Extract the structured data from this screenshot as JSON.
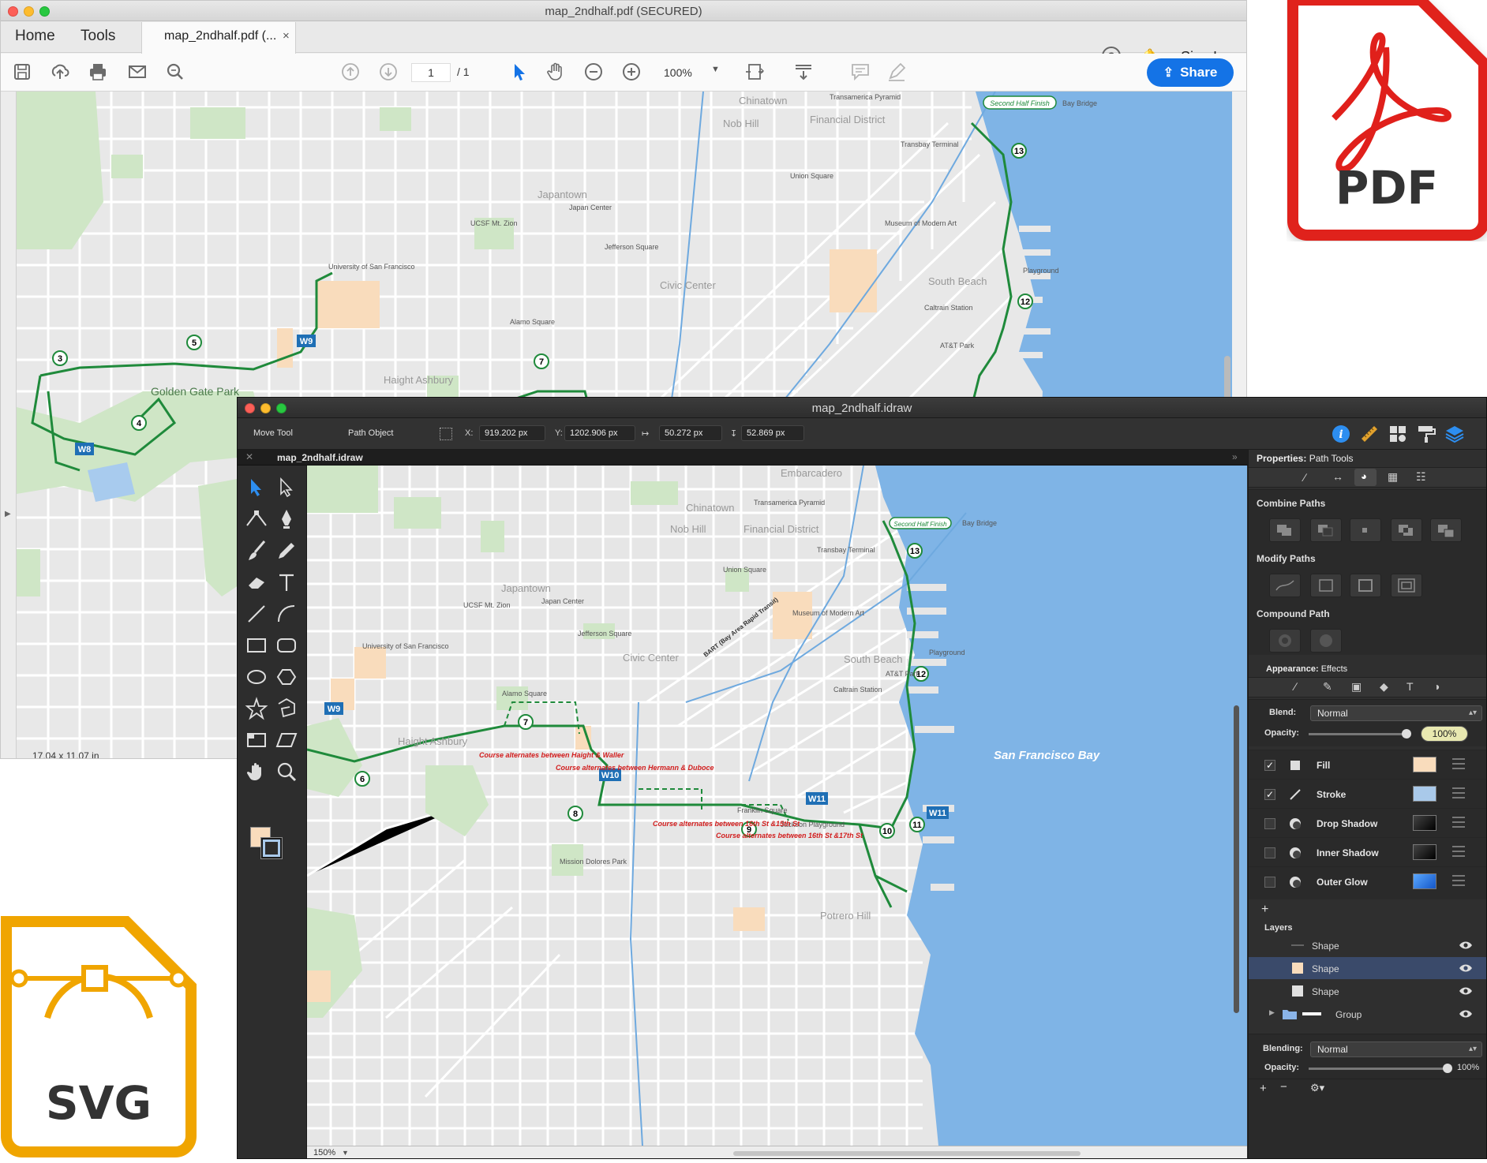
{
  "acrobat": {
    "title": "map_2ndhalf.pdf (SECURED)",
    "menu": {
      "home": "Home",
      "tools": "Tools"
    },
    "tab_label": "map_2ndhalf.pdf (...",
    "tab_close": "×",
    "help": "?",
    "sign_in": "Sign In",
    "page_current": "1",
    "page_total": "/  1",
    "zoom": "100%",
    "share": "Share",
    "status": "17.04 x 11.07 in",
    "icons": [
      "save-icon",
      "upload-icon",
      "print-icon",
      "email-icon",
      "search-icon",
      "page-up-icon",
      "page-down-icon",
      "pointer-icon",
      "hand-icon",
      "zoom-out-icon",
      "zoom-in-icon",
      "fit-page-icon",
      "scroll-mode-icon",
      "comment-icon",
      "pen-icon",
      "help-icon",
      "bell-icon"
    ]
  },
  "idraw": {
    "title": "map_2ndhalf.idraw",
    "toolbar": {
      "move_tool": "Move Tool",
      "path_object": "Path Object",
      "x_label": "X:",
      "x_value": "919.202 px",
      "y_label": "Y:",
      "y_value": "1202.906 px",
      "w_value": "50.272 px",
      "h_value": "52.869 px"
    },
    "tab_label": "map_2ndhalf.idraw",
    "zoom": "150%",
    "panel": {
      "properties_label": "Properties:",
      "properties_value": "Path Tools",
      "combine_paths": "Combine Paths",
      "modify_paths": "Modify Paths",
      "compound_path": "Compound Path",
      "appearance_label": "Appearance:",
      "appearance_value": "Effects",
      "blend_label": "Blend:",
      "blend_value": "Normal",
      "opacity_label": "Opacity:",
      "opacity_value": "100%",
      "effects": [
        {
          "name": "Fill",
          "checked": true,
          "color": "#f9dcbc"
        },
        {
          "name": "Stroke",
          "checked": true,
          "color": "#a9c9ea"
        },
        {
          "name": "Drop Shadow",
          "checked": false,
          "color": "#111111"
        },
        {
          "name": "Inner Shadow",
          "checked": false,
          "color": "#111111"
        },
        {
          "name": "Outer Glow",
          "checked": false,
          "color": "#2f7fe0"
        }
      ],
      "add": "+",
      "layers_label": "Layers",
      "layers": [
        {
          "name": "Shape"
        },
        {
          "name": "Shape"
        },
        {
          "name": "Shape"
        },
        {
          "name": "Group"
        }
      ],
      "blending_label": "Blending:",
      "blending_value": "Normal",
      "layer_opacity_label": "Opacity:",
      "layer_opacity_value": "100%"
    }
  },
  "map": {
    "labels": {
      "chinatown": "Chinatown",
      "nob_hill": "Nob Hill",
      "financial_district": "Financial District",
      "transamerica": "Transamerica Pyramid",
      "japantown": "Japantown",
      "japan_center": "Japan Center",
      "jefferson_square": "Jefferson Square",
      "civic_center": "Civic Center",
      "union_square": "Union Square",
      "south_beach": "South Beach",
      "museum": "Museum of Modern Art",
      "transbay": "Transbay Terminal",
      "golden_gate_park": "Golden Gate Park",
      "alamo_square": "Alamo Square",
      "usf": "University of San Francisco",
      "ucsf": "UCSF Mt. Zion",
      "haight": "Haight Ashbury",
      "second_half": "Second Half Finish",
      "bay_bridge": "Bay Bridge",
      "playground": "Playground",
      "att_park": "AT&T Park",
      "caltrain": "Caltrain Station",
      "sf_bay": "San Francisco Bay",
      "mission_dolores": "Mission Dolores Park",
      "embarcadero": "Embarcadero",
      "potrero_hill": "Potrero Hill",
      "franklin_square": "Franklin Square",
      "jackson_playground": "Jackson Playground",
      "course_note_1": "Course alternates between Haight & Waller",
      "course_note_2": "Course alternates between Hermann & Duboce",
      "course_note_3": "Course alternates between 16th St &15th St",
      "course_note_4": "Course alternates between 16th St &17th St",
      "bart": "BART (Bay Area Rapid Transit)"
    },
    "markers": [
      "3",
      "4",
      "5",
      "6",
      "7",
      "8",
      "9",
      "10",
      "11",
      "12",
      "13"
    ],
    "water_badges": [
      "W8",
      "W9",
      "W10",
      "W11"
    ]
  },
  "badges": {
    "pdf": "PDF",
    "svg": "SVG"
  },
  "colors": {
    "map_bg": "#e6e6e6",
    "park": "#cfe6c6",
    "water": "#7fb4e6",
    "route": "#1f8a3b",
    "accent_blue": "#1473e6",
    "pdf_red": "#e0201b",
    "svg_orange": "#f0a500"
  }
}
